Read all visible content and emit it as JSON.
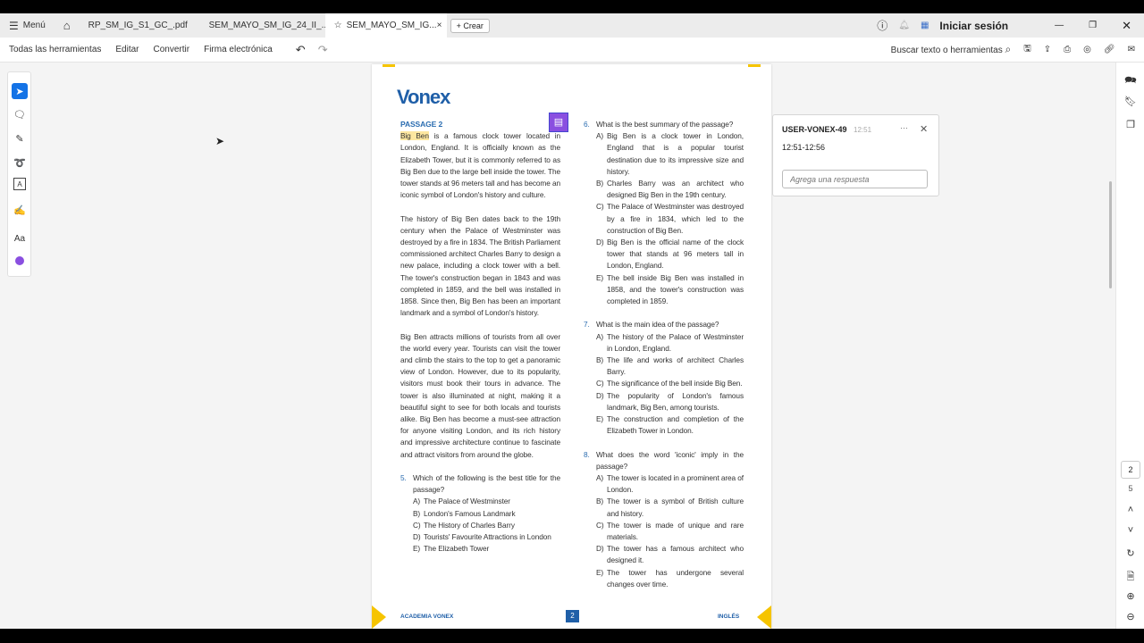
{
  "tabs": {
    "menu": "Menú",
    "tab1": "RP_SM_IG_S1_GC_.pdf",
    "tab2": "SEM_MAYO_SM_IG_24_II_...",
    "tab3": "SEM_MAYO_SM_IG...",
    "create": "Crear",
    "signin": "Iniciar sesión"
  },
  "toolbar": {
    "all_tools": "Todas las herramientas",
    "edit": "Editar",
    "convert": "Convertir",
    "esign": "Firma electrónica",
    "search": "Buscar texto o herramientas"
  },
  "page": {
    "logo": "Vonex",
    "passage_title": "PASSAGE 2",
    "highlight": "Big Ben",
    "p1_rest": " is a famous clock tower located in London, England. It is officially known as the Elizabeth Tower, but it is commonly referred to as Big Ben due to the large bell inside the tower. The tower stands at 96 meters tall and has become an iconic symbol of London's history and culture.",
    "p2": "The history of Big Ben dates back to the 19th century when the Palace of Westminster was destroyed by a fire in 1834. The British Parliament commissioned architect Charles Barry to design a new palace, including a clock tower with a bell. The tower's construction began in 1843 and was completed in 1859, and the bell was installed in 1858. Since then, Big Ben has been an important landmark and a symbol of London's history.",
    "p3": "Big Ben attracts millions of tourists from all over the world every year. Tourists can visit the tower and climb the stairs to the top to get a panoramic view of London. However, due to its popularity, visitors must book their tours in advance. The tower is also illuminated at night, making it a beautiful sight to see for both locals and tourists alike. Big Ben has become a must-see attraction for anyone visiting London, and its rich history and impressive architecture continue to fascinate and attract visitors from around the globe.",
    "questions": [
      {
        "n": "5.",
        "q": "Which of the following is the best title for the passage?",
        "opts": [
          [
            "A)",
            "The Palace of Westminster"
          ],
          [
            "B)",
            "London's Famous Landmark"
          ],
          [
            "C)",
            "The History of Charles Barry"
          ],
          [
            "D)",
            "Tourists' Favourite Attractions in London"
          ],
          [
            "E)",
            "The Elizabeth Tower"
          ]
        ]
      },
      {
        "n": "6.",
        "q": "What is the best summary of the passage?",
        "opts": [
          [
            "A)",
            "Big Ben is a clock tower in London, England that is a popular tourist destination due to its impressive size and history."
          ],
          [
            "B)",
            "Charles Barry was an architect who designed Big Ben in the 19th century."
          ],
          [
            "C)",
            "The Palace of Westminster was destroyed by a fire in 1834, which led to the construction of Big Ben."
          ],
          [
            "D)",
            "Big Ben is the official name of the clock tower that stands at 96 meters tall in London, England."
          ],
          [
            "E)",
            "The bell inside Big Ben was installed in 1858, and the tower's construction was completed in 1859."
          ]
        ]
      },
      {
        "n": "7.",
        "q": "What is the main idea of the passage?",
        "opts": [
          [
            "A)",
            "The history of the Palace of Westminster in London, England."
          ],
          [
            "B)",
            "The life and works of architect Charles Barry."
          ],
          [
            "C)",
            "The significance of the bell inside Big Ben."
          ],
          [
            "D)",
            "The popularity of London's famous landmark, Big Ben, among tourists."
          ],
          [
            "E)",
            "The construction and completion of the Elizabeth Tower in London."
          ]
        ]
      },
      {
        "n": "8.",
        "q": "What does the word 'iconic' imply in the passage?",
        "opts": [
          [
            "A)",
            "The tower is located in a prominent area of London."
          ],
          [
            "B)",
            "The tower is a symbol of British culture and history."
          ],
          [
            "C)",
            "The tower is made of unique and rare materials."
          ],
          [
            "D)",
            "The tower has a famous architect who designed it."
          ],
          [
            "E)",
            "The tower has undergone several changes over time."
          ]
        ]
      }
    ],
    "footer_left": "ACADEMIA VONEX",
    "footer_page": "2",
    "footer_right": "INGLÉS"
  },
  "comment": {
    "user": "USER-VONEX-49",
    "time": "12:51",
    "body": "12:51-12:56",
    "reply_placeholder": "Agrega una respuesta"
  },
  "pager": {
    "current": "2",
    "total": "5"
  }
}
